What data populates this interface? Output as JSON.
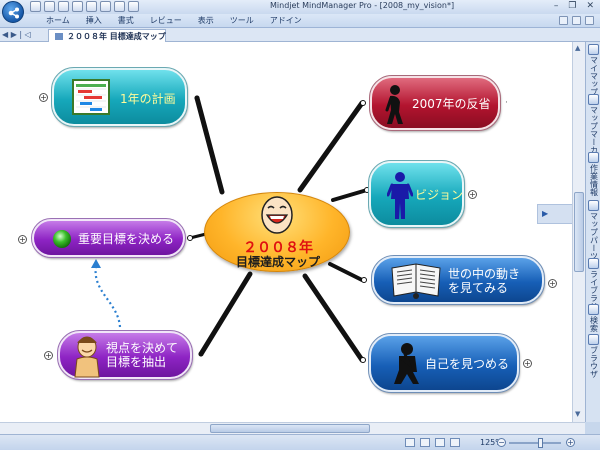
{
  "window": {
    "title": "Mindjet MindManager Pro - [2008_my_vision*]",
    "controls": [
      "–",
      "❐",
      "✕"
    ]
  },
  "ribbon": {
    "tabs": [
      "ホーム",
      "挿入",
      "書式",
      "レビュー",
      "表示",
      "ツール",
      "アドイン"
    ]
  },
  "document": {
    "tab_label": "２００８年 目標達成マップ",
    "nav": "◀ ▶ | ◁"
  },
  "map": {
    "central": {
      "year": "２００８年",
      "title": "目標達成マップ"
    },
    "topics": {
      "plan": {
        "label": "1年の計画",
        "color": "teal"
      },
      "reflect": {
        "label": "2007年の反省",
        "color": "red"
      },
      "vision": {
        "label": "ビジョン",
        "color": "teal"
      },
      "goals": {
        "label": "重要目標を決める",
        "color": "purple"
      },
      "world": {
        "label_line1": "世の中の動き",
        "label_line2": "を見てみる",
        "color": "blue"
      },
      "viewpoint": {
        "label_line1": "視点を決めて",
        "label_line2": "目標を抽出",
        "color": "purple"
      },
      "self": {
        "label": "自己を見つめる",
        "color": "blue"
      }
    },
    "expander_symbol": "+"
  },
  "sidebar": {
    "items": [
      "マイマップ",
      "マップマーカー",
      "作業情報",
      "マップパーツ",
      "ライブラリ",
      "検索",
      "ブラウザ"
    ],
    "flap_symbol": "▶"
  },
  "status": {
    "zoom": "125%",
    "zoom_minus": "−",
    "zoom_plus": "+"
  },
  "colors": {
    "teal": "#16a8bb",
    "red": "#b3142f",
    "purple": "#8e24c4",
    "blue": "#175fb7",
    "central": "#ffb52a",
    "year_text": "#e01010",
    "canvas": "#ffffff",
    "chrome": "#c7d7ec"
  },
  "icons": {
    "app": "app-orb-icon",
    "plan": "gantt-chart-icon",
    "reflect": "person-bowing-icon",
    "vision": "person-standing-icon",
    "goals": "green-ball-icon",
    "world": "newspaper-reader-icon",
    "viewpoint": "smiling-man-icon",
    "self": "person-thinking-icon",
    "central": "laughing-face-icon"
  }
}
